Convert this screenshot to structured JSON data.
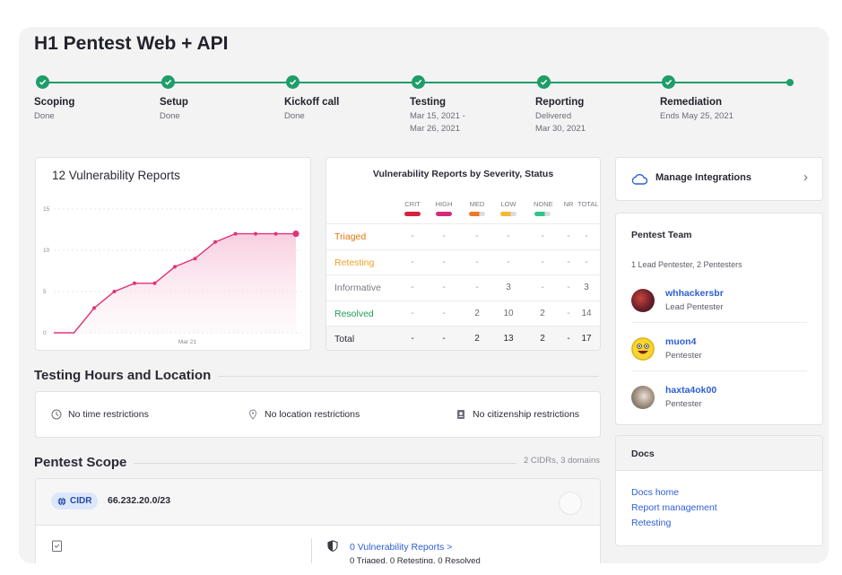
{
  "page": {
    "title": "H1 Pentest Web + API"
  },
  "timeline": [
    {
      "name": "Scoping",
      "sub": "Done"
    },
    {
      "name": "Setup",
      "sub": "Done"
    },
    {
      "name": "Kickoff call",
      "sub": "Done"
    },
    {
      "name": "Testing",
      "sub": "Mar 15, 2021 -\nMar 26, 2021"
    },
    {
      "name": "Reporting",
      "sub": "Delivered\nMar 30, 2021"
    },
    {
      "name": "Remediation",
      "sub": "Ends May 25, 2021"
    }
  ],
  "chart_data": {
    "type": "line",
    "title": "12 Vulnerability Reports",
    "yticks": [
      0,
      5,
      10,
      15
    ],
    "ylim": [
      0,
      15
    ],
    "xtick_label": "Mar 21",
    "x": [
      1,
      2,
      3,
      4,
      5,
      6,
      7,
      8,
      9,
      10,
      11,
      12,
      13
    ],
    "values": [
      0,
      0,
      3,
      5,
      6,
      6,
      8,
      9,
      11,
      12,
      12,
      12,
      12
    ],
    "color": "#e0337a",
    "grid": true
  },
  "severity_table": {
    "title": "Vulnerability Reports by Severity, Status",
    "columns": [
      {
        "label": "CRIT",
        "color": "#d6233a"
      },
      {
        "label": "HIGH",
        "color": "#d42a7c"
      },
      {
        "label": "MED",
        "color": "#f07826"
      },
      {
        "label": "LOW",
        "color": "#f3b936"
      },
      {
        "label": "NONE",
        "color": "#31c48d"
      },
      {
        "label": "NR",
        "color": ""
      },
      {
        "label": "TOTAL",
        "color": ""
      }
    ],
    "rows": [
      {
        "label": "Triaged",
        "color": "#e0780f",
        "cells": [
          "-",
          "-",
          "-",
          "-",
          "-",
          "-",
          "-"
        ]
      },
      {
        "label": "Retesting",
        "color": "#f0a028",
        "cells": [
          "-",
          "-",
          "-",
          "-",
          "-",
          "-",
          "-"
        ]
      },
      {
        "label": "Informative",
        "color": "#7a7a84",
        "cells": [
          "-",
          "-",
          "-",
          "3",
          "-",
          "-",
          "3"
        ]
      },
      {
        "label": "Resolved",
        "color": "#1f9d55",
        "cells": [
          "-",
          "-",
          "2",
          "10",
          "2",
          "-",
          "14"
        ]
      },
      {
        "label": "Total",
        "color": "#2a2a35",
        "cells": [
          "-",
          "-",
          "2",
          "13",
          "2",
          "-",
          "17"
        ]
      }
    ]
  },
  "integrations": {
    "label": "Manage Integrations"
  },
  "team": {
    "title": "Pentest Team",
    "summary": "1 Lead Pentester, 2 Pentesters",
    "members": [
      {
        "name": "whhackersbr",
        "role": "Lead Pentester"
      },
      {
        "name": "muon4",
        "role": "Pentester"
      },
      {
        "name": "haxta4ok00",
        "role": "Pentester"
      }
    ]
  },
  "docs": {
    "title": "Docs",
    "links": [
      "Docs home",
      "Report management",
      "Retesting"
    ]
  },
  "hours": {
    "title": "Testing Hours and Location",
    "items": [
      {
        "label": "No time restrictions",
        "icon": "clock-icon"
      },
      {
        "label": "No location restrictions",
        "icon": "location-pin-icon"
      },
      {
        "label": "No citizenship restrictions",
        "icon": "passport-icon"
      }
    ]
  },
  "scope": {
    "title": "Pentest Scope",
    "count": "2 CIDRs, 3 domains",
    "asset_type": "CIDR",
    "asset_value": "66.232.20.0/23",
    "reports_link": "0 Vulnerability Reports >",
    "reports_sub": "0 Triaged, 0 Retesting, 0 Resolved"
  }
}
